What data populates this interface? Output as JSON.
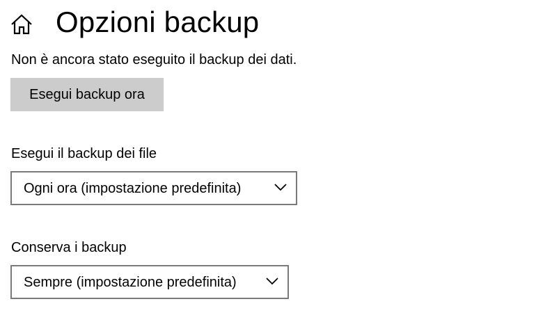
{
  "header": {
    "home_icon": "home-icon",
    "title": "Opzioni backup"
  },
  "status": {
    "text": "Non è ancora stato eseguito il backup dei dati."
  },
  "actions": {
    "backup_now_label": "Esegui backup ora"
  },
  "frequency": {
    "label": "Esegui il backup dei file",
    "selected": "Ogni ora (impostazione predefinita)",
    "icon": "chevron-down-icon"
  },
  "retention": {
    "label": "Conserva i backup",
    "selected": "Sempre (impostazione predefinita)",
    "icon": "chevron-down-icon"
  },
  "colors": {
    "button_background": "#cccccc",
    "dropdown_border": "#7a7a7a",
    "text": "#000000",
    "background": "#ffffff"
  }
}
